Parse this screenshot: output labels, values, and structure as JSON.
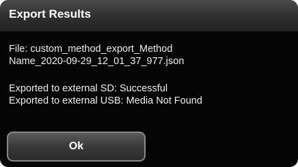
{
  "dialog": {
    "title": "Export Results",
    "file_line1": "File: custom_method_export_Method",
    "file_line2": "Name_2020-09-29_12_01_37_977.json",
    "status_sd": "Exported to external SD: Successful",
    "status_usb": "Exported to external USB: Media Not Found",
    "ok_label": "Ok"
  }
}
